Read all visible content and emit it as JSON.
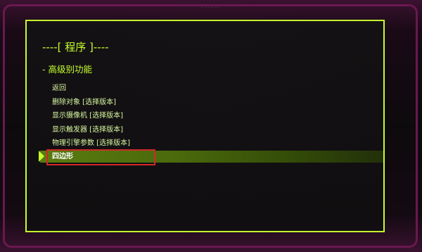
{
  "panel": {
    "title": "----[ 程序 ]----",
    "section": "- 高级别功能"
  },
  "menu": {
    "items": [
      {
        "label": "返回"
      },
      {
        "label": "删除对象 [选择版本]"
      },
      {
        "label": "显示摄像机 [选择版本]"
      },
      {
        "label": "显示触发器 [选择版本]"
      },
      {
        "label": "物理引擎参数 [选择版本]"
      },
      {
        "label": "四边形"
      }
    ],
    "selected_index": 5
  },
  "colors": {
    "accent": "#c6ff2e",
    "selection_bar": "#4a6a0c",
    "highlight_box": "#d02828",
    "frame": "#6a1850"
  },
  "icons": {
    "selection_indicator": "triangle-right-icon"
  }
}
